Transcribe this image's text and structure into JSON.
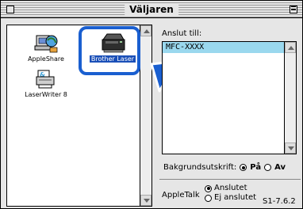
{
  "window": {
    "title": "Väljaren"
  },
  "left_list": {
    "items": [
      {
        "label": "AppleShare",
        "icon": "appleshare-icon"
      },
      {
        "label": "LaserWriter 8",
        "icon": "laserwriter-icon"
      },
      {
        "label": "Brother Laser",
        "icon": "brother-laser-icon",
        "selected": true
      }
    ]
  },
  "connect": {
    "label": "Anslut till:",
    "selected_value": "MFC-XXXX"
  },
  "background_printing": {
    "label": "Bakgrundsutskrift:",
    "on_label": "På",
    "off_label": "Av",
    "selected": "on"
  },
  "appletalk": {
    "label": "AppleTalk",
    "connected_label": "Anslutet",
    "disconnected_label": "Ej anslutet",
    "selected": "connected"
  },
  "version": "S1-7.6.2",
  "colors": {
    "highlight": "#1a5fd0",
    "arrow": "#1a5fd0",
    "list_selection": "#9ad8ee"
  }
}
